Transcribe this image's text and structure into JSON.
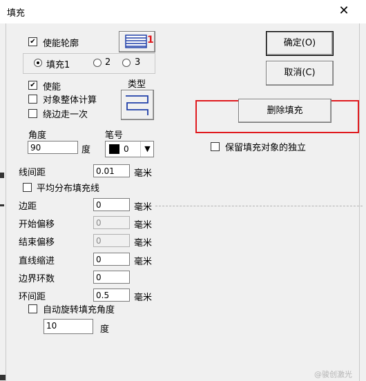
{
  "window": {
    "title": "填充"
  },
  "outline": {
    "enable_label": "使能轮廓",
    "enable_checked": true
  },
  "fill_tabs": [
    {
      "label": "填充1",
      "selected": true
    },
    {
      "label": "2",
      "selected": false
    },
    {
      "label": "3",
      "selected": false
    }
  ],
  "fill_options": {
    "enable_label": "使能",
    "enable_checked": true,
    "whole_label": "对象整体计算",
    "whole_checked": false,
    "once_label": "绕边走一次",
    "once_checked": false,
    "type_label": "类型"
  },
  "angle": {
    "label": "角度",
    "value": "90",
    "unit": "度"
  },
  "pen": {
    "label": "笔号",
    "value": "0",
    "swatch_color": "#000000"
  },
  "params": {
    "line_spacing": {
      "label": "线间距",
      "value": "0.01",
      "unit": "毫米"
    },
    "even_label": "平均分布填充线",
    "even_checked": false,
    "margin": {
      "label": "边距",
      "value": "0",
      "unit": "毫米"
    },
    "start_offset": {
      "label": "开始偏移",
      "value": "0",
      "unit": "毫米"
    },
    "end_offset": {
      "label": "结束偏移",
      "value": "0",
      "unit": "毫米"
    },
    "line_reduce": {
      "label": "直线缩进",
      "value": "0",
      "unit": "毫米"
    },
    "border_loops": {
      "label": "边界环数",
      "value": "0"
    },
    "loop_spacing": {
      "label": "环间距",
      "value": "0.5",
      "unit": "毫米"
    },
    "auto_rotate_label": "自动旋转填充角度",
    "auto_rotate_checked": false,
    "rotate_value": "10",
    "rotate_unit": "度"
  },
  "buttons": {
    "ok": "确定(O)",
    "cancel": "取消(C)",
    "delete_fill": "删除填充"
  },
  "keep_independent": {
    "label": "保留填充对象的独立",
    "checked": false
  },
  "pattern_badge": "1",
  "watermark": "@骏创激光",
  "colors": {
    "highlight": "#e0191e",
    "icon_blue": "#1f3fa8"
  }
}
